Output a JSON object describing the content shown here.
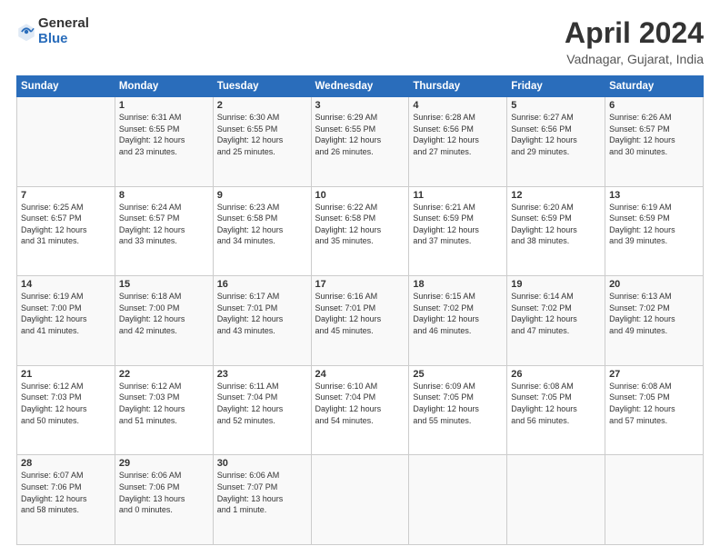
{
  "logo": {
    "general": "General",
    "blue": "Blue"
  },
  "header": {
    "month": "April 2024",
    "location": "Vadnagar, Gujarat, India"
  },
  "weekdays": [
    "Sunday",
    "Monday",
    "Tuesday",
    "Wednesday",
    "Thursday",
    "Friday",
    "Saturday"
  ],
  "weeks": [
    [
      {
        "day": "",
        "info": ""
      },
      {
        "day": "1",
        "info": "Sunrise: 6:31 AM\nSunset: 6:55 PM\nDaylight: 12 hours\nand 23 minutes."
      },
      {
        "day": "2",
        "info": "Sunrise: 6:30 AM\nSunset: 6:55 PM\nDaylight: 12 hours\nand 25 minutes."
      },
      {
        "day": "3",
        "info": "Sunrise: 6:29 AM\nSunset: 6:55 PM\nDaylight: 12 hours\nand 26 minutes."
      },
      {
        "day": "4",
        "info": "Sunrise: 6:28 AM\nSunset: 6:56 PM\nDaylight: 12 hours\nand 27 minutes."
      },
      {
        "day": "5",
        "info": "Sunrise: 6:27 AM\nSunset: 6:56 PM\nDaylight: 12 hours\nand 29 minutes."
      },
      {
        "day": "6",
        "info": "Sunrise: 6:26 AM\nSunset: 6:57 PM\nDaylight: 12 hours\nand 30 minutes."
      }
    ],
    [
      {
        "day": "7",
        "info": "Sunrise: 6:25 AM\nSunset: 6:57 PM\nDaylight: 12 hours\nand 31 minutes."
      },
      {
        "day": "8",
        "info": "Sunrise: 6:24 AM\nSunset: 6:57 PM\nDaylight: 12 hours\nand 33 minutes."
      },
      {
        "day": "9",
        "info": "Sunrise: 6:23 AM\nSunset: 6:58 PM\nDaylight: 12 hours\nand 34 minutes."
      },
      {
        "day": "10",
        "info": "Sunrise: 6:22 AM\nSunset: 6:58 PM\nDaylight: 12 hours\nand 35 minutes."
      },
      {
        "day": "11",
        "info": "Sunrise: 6:21 AM\nSunset: 6:59 PM\nDaylight: 12 hours\nand 37 minutes."
      },
      {
        "day": "12",
        "info": "Sunrise: 6:20 AM\nSunset: 6:59 PM\nDaylight: 12 hours\nand 38 minutes."
      },
      {
        "day": "13",
        "info": "Sunrise: 6:19 AM\nSunset: 6:59 PM\nDaylight: 12 hours\nand 39 minutes."
      }
    ],
    [
      {
        "day": "14",
        "info": "Sunrise: 6:19 AM\nSunset: 7:00 PM\nDaylight: 12 hours\nand 41 minutes."
      },
      {
        "day": "15",
        "info": "Sunrise: 6:18 AM\nSunset: 7:00 PM\nDaylight: 12 hours\nand 42 minutes."
      },
      {
        "day": "16",
        "info": "Sunrise: 6:17 AM\nSunset: 7:01 PM\nDaylight: 12 hours\nand 43 minutes."
      },
      {
        "day": "17",
        "info": "Sunrise: 6:16 AM\nSunset: 7:01 PM\nDaylight: 12 hours\nand 45 minutes."
      },
      {
        "day": "18",
        "info": "Sunrise: 6:15 AM\nSunset: 7:02 PM\nDaylight: 12 hours\nand 46 minutes."
      },
      {
        "day": "19",
        "info": "Sunrise: 6:14 AM\nSunset: 7:02 PM\nDaylight: 12 hours\nand 47 minutes."
      },
      {
        "day": "20",
        "info": "Sunrise: 6:13 AM\nSunset: 7:02 PM\nDaylight: 12 hours\nand 49 minutes."
      }
    ],
    [
      {
        "day": "21",
        "info": "Sunrise: 6:12 AM\nSunset: 7:03 PM\nDaylight: 12 hours\nand 50 minutes."
      },
      {
        "day": "22",
        "info": "Sunrise: 6:12 AM\nSunset: 7:03 PM\nDaylight: 12 hours\nand 51 minutes."
      },
      {
        "day": "23",
        "info": "Sunrise: 6:11 AM\nSunset: 7:04 PM\nDaylight: 12 hours\nand 52 minutes."
      },
      {
        "day": "24",
        "info": "Sunrise: 6:10 AM\nSunset: 7:04 PM\nDaylight: 12 hours\nand 54 minutes."
      },
      {
        "day": "25",
        "info": "Sunrise: 6:09 AM\nSunset: 7:05 PM\nDaylight: 12 hours\nand 55 minutes."
      },
      {
        "day": "26",
        "info": "Sunrise: 6:08 AM\nSunset: 7:05 PM\nDaylight: 12 hours\nand 56 minutes."
      },
      {
        "day": "27",
        "info": "Sunrise: 6:08 AM\nSunset: 7:05 PM\nDaylight: 12 hours\nand 57 minutes."
      }
    ],
    [
      {
        "day": "28",
        "info": "Sunrise: 6:07 AM\nSunset: 7:06 PM\nDaylight: 12 hours\nand 58 minutes."
      },
      {
        "day": "29",
        "info": "Sunrise: 6:06 AM\nSunset: 7:06 PM\nDaylight: 13 hours\nand 0 minutes."
      },
      {
        "day": "30",
        "info": "Sunrise: 6:06 AM\nSunset: 7:07 PM\nDaylight: 13 hours\nand 1 minute."
      },
      {
        "day": "",
        "info": ""
      },
      {
        "day": "",
        "info": ""
      },
      {
        "day": "",
        "info": ""
      },
      {
        "day": "",
        "info": ""
      }
    ]
  ]
}
